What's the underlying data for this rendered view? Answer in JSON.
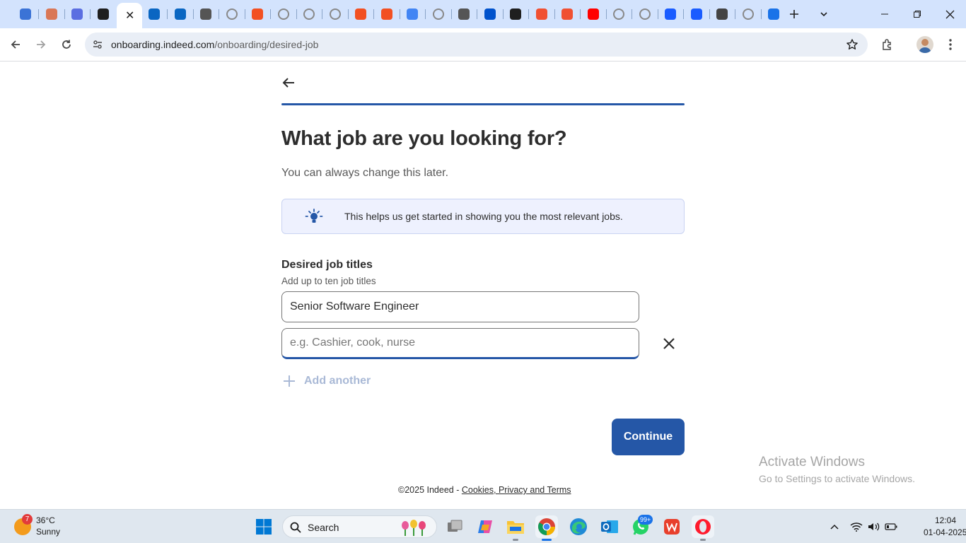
{
  "browser": {
    "url_host": "onboarding.indeed.com",
    "url_path": "/onboarding/desired-job",
    "tabs": [
      {
        "icon": "copilot-icon",
        "color": "#3b73d6"
      },
      {
        "icon": "claude-icon",
        "color": "#d97757"
      },
      {
        "icon": "gemini-icon",
        "color": "#5b6ee1"
      },
      {
        "icon": "chatgpt-icon",
        "color": "#1f1f1f"
      },
      {
        "icon": "indeed-icon",
        "color": "#1f1f1f",
        "active": true
      },
      {
        "icon": "linkedin-icon",
        "color": "#0a66c2"
      },
      {
        "icon": "linkedin-icon",
        "color": "#0a66c2"
      },
      {
        "icon": "doc-icon",
        "color": "#555"
      },
      {
        "icon": "globe-icon",
        "color": "#888"
      },
      {
        "icon": "microsoft-icon",
        "color": "#f25022"
      },
      {
        "icon": "globe-icon",
        "color": "#888"
      },
      {
        "icon": "globe-icon",
        "color": "#888"
      },
      {
        "icon": "globe-icon",
        "color": "#888"
      },
      {
        "icon": "microsoft-icon",
        "color": "#f25022"
      },
      {
        "icon": "microsoft-icon",
        "color": "#f25022"
      },
      {
        "icon": "google-icon",
        "color": "#4285f4"
      },
      {
        "icon": "globe-icon",
        "color": "#888"
      },
      {
        "icon": "doc-icon",
        "color": "#555"
      },
      {
        "icon": "confluence-icon",
        "color": "#0052cc"
      },
      {
        "icon": "anthropic-icon",
        "color": "#1f1f1f"
      },
      {
        "icon": "git-icon",
        "color": "#f05032"
      },
      {
        "icon": "git-icon",
        "color": "#f05032"
      },
      {
        "icon": "youtube-icon",
        "color": "#ff0000"
      },
      {
        "icon": "globe-icon",
        "color": "#888"
      },
      {
        "icon": "globe-icon",
        "color": "#888"
      },
      {
        "icon": "k-icon",
        "color": "#1a5cff"
      },
      {
        "icon": "k-icon",
        "color": "#1a5cff"
      },
      {
        "icon": "chrome-icon",
        "color": "#444"
      },
      {
        "icon": "globe-icon",
        "color": "#888"
      },
      {
        "icon": "download-icon",
        "color": "#1a73e8"
      }
    ]
  },
  "page": {
    "heading": "What job are you looking for?",
    "subheading": "You can always change this later.",
    "info_message": "This helps us get started in showing you the most relevant jobs.",
    "field_label": "Desired job titles",
    "field_hint": "Add up to ten job titles",
    "job_titles": [
      {
        "value": "Senior Software Engineer"
      },
      {
        "value": "",
        "placeholder": "e.g. Cashier, cook, nurse"
      }
    ],
    "add_another": "Add another",
    "continue": "Continue",
    "footer_copyright": "©2025 Indeed - ",
    "footer_link": "Cookies, Privacy and Terms",
    "progress": 1.0,
    "accent_color": "#2557a7"
  },
  "watermark": {
    "title": "Activate Windows",
    "subtitle": "Go to Settings to activate Windows."
  },
  "taskbar": {
    "weather_badge": "7",
    "temperature": "36°C",
    "condition": "Sunny",
    "search_label": "Search",
    "whatsapp_badge": "99+",
    "time": "12:04",
    "date": "01-04-2025"
  }
}
